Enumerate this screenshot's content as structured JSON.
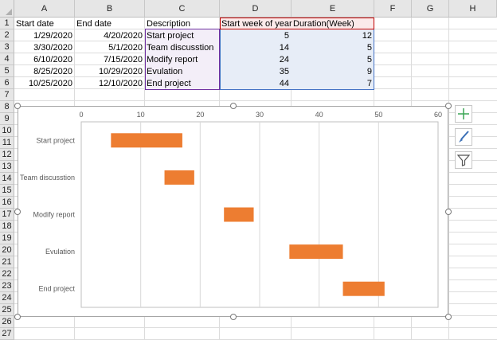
{
  "columns": [
    "A",
    "B",
    "C",
    "D",
    "E",
    "F",
    "G",
    "H"
  ],
  "rows": [
    "1",
    "2",
    "3",
    "4",
    "5",
    "6",
    "7",
    "8",
    "9",
    "10",
    "11",
    "12",
    "13",
    "14",
    "15",
    "16",
    "17",
    "18",
    "19",
    "20",
    "21",
    "22",
    "23",
    "24",
    "25",
    "26",
    "27"
  ],
  "headers": {
    "start_date": "Start date",
    "end_date": "End date",
    "description": "Description",
    "start_week": "Start week of year",
    "duration": "Duration(Week)"
  },
  "table": [
    {
      "start": "1/29/2020",
      "end": "4/20/2020",
      "desc": "Start project",
      "week": "5",
      "dur": "12"
    },
    {
      "start": "3/30/2020",
      "end": "5/1/2020",
      "desc": "Team discusstion",
      "week": "14",
      "dur": "5"
    },
    {
      "start": "6/10/2020",
      "end": "7/15/2020",
      "desc": "Modify report",
      "week": "24",
      "dur": "5"
    },
    {
      "start": "8/25/2020",
      "end": "10/29/2020",
      "desc": "Evulation",
      "week": "35",
      "dur": "9"
    },
    {
      "start": "10/25/2020",
      "end": "12/10/2020",
      "desc": "End project",
      "week": "44",
      "dur": "7"
    }
  ],
  "chart_data": {
    "type": "bar",
    "orientation": "horizontal",
    "stacked": true,
    "categories": [
      "Start project",
      "Team discusstion",
      "Modify report",
      "Evulation",
      "End project"
    ],
    "series": [
      {
        "name": "Start week of year",
        "values": [
          5,
          14,
          24,
          35,
          44
        ],
        "visible": false
      },
      {
        "name": "Duration(Week)",
        "values": [
          12,
          5,
          5,
          9,
          7
        ],
        "color": "#ed7d31"
      }
    ],
    "x_ticks": [
      "0",
      "10",
      "20",
      "30",
      "40",
      "50",
      "60"
    ],
    "xlim": [
      0,
      60
    ],
    "x_axis_position": "top",
    "grid": "vertical",
    "legend": "none"
  },
  "side_buttons": {
    "plus_icon": "chart-elements-icon",
    "brush_icon": "chart-styles-icon",
    "filter_icon": "chart-filters-icon"
  }
}
